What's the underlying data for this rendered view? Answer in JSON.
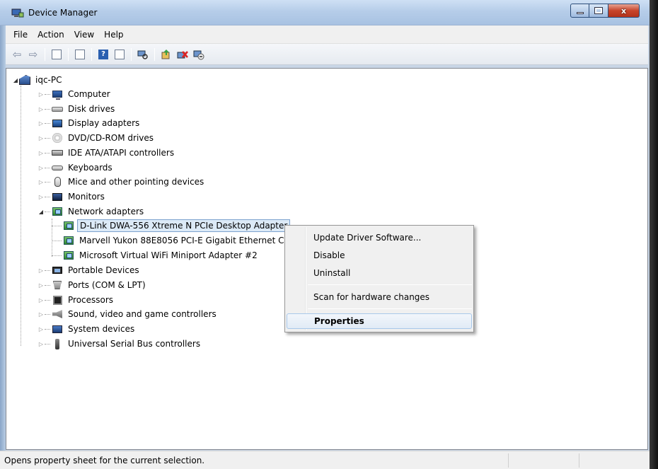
{
  "window": {
    "title": "Device Manager",
    "close_glyph": "x"
  },
  "menu": [
    "File",
    "Action",
    "View",
    "Help"
  ],
  "toolbar": {
    "icons": [
      "back-arrow-icon",
      "forward-arrow-icon",
      "show-hide-console-tree-icon",
      "properties-icon",
      "help-icon",
      "action-pane-icon",
      "scan-hardware-icon",
      "update-driver-icon",
      "uninstall-icon",
      "disable-icon"
    ],
    "help_glyph": "?"
  },
  "tree": {
    "root": "iqc-PC",
    "categories": [
      {
        "label": "Computer",
        "icon": "computer-icon"
      },
      {
        "label": "Disk drives",
        "icon": "disk-drive-icon"
      },
      {
        "label": "Display adapters",
        "icon": "display-adapter-icon"
      },
      {
        "label": "DVD/CD-ROM drives",
        "icon": "dvd-drive-icon"
      },
      {
        "label": "IDE ATA/ATAPI controllers",
        "icon": "ide-controller-icon"
      },
      {
        "label": "Keyboards",
        "icon": "keyboard-icon"
      },
      {
        "label": "Mice and other pointing devices",
        "icon": "mouse-icon"
      },
      {
        "label": "Monitors",
        "icon": "monitor-icon"
      },
      {
        "label": "Network adapters",
        "icon": "network-adapter-icon"
      }
    ],
    "network_children": [
      "D-Link DWA-556 Xtreme N PCIe Desktop Adapter",
      "Marvell Yukon 88E8056 PCI-E Gigabit Ethernet C",
      "Microsoft Virtual WiFi Miniport Adapter #2"
    ],
    "categories_after": [
      {
        "label": "Portable Devices",
        "icon": "portable-device-icon"
      },
      {
        "label": "Ports (COM & LPT)",
        "icon": "port-icon"
      },
      {
        "label": "Processors",
        "icon": "processor-icon"
      },
      {
        "label": "Sound, video and game controllers",
        "icon": "sound-icon"
      },
      {
        "label": "System devices",
        "icon": "system-device-icon"
      },
      {
        "label": "Universal Serial Bus controllers",
        "icon": "usb-icon"
      }
    ]
  },
  "context_menu": {
    "items": [
      "Update Driver Software...",
      "Disable",
      "Uninstall",
      "Scan for hardware changes",
      "Properties"
    ]
  },
  "status": {
    "text": "Opens property sheet for the current selection."
  }
}
